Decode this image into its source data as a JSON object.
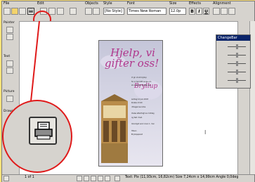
{
  "menu": {
    "file": "File",
    "edit": "Edit",
    "objects": "Objects",
    "style": "Style",
    "font": "Font",
    "size": "Size",
    "effects": "Effects",
    "alignment": "Alignment"
  },
  "toolbar": {
    "style_value": "[No Style]",
    "font_value": "Times New Roman",
    "size_value": "12.0p",
    "bold": "B",
    "italic": "I",
    "underline": "U"
  },
  "left_panel": {
    "pointer": "Pointer",
    "text": "Text",
    "picture": "Picture",
    "drawing": "Drawing"
  },
  "document": {
    "headline_line1": "Hjelp, vi",
    "headline_line2": "gifter oss!",
    "subtitle": "Bryllup",
    "body_lines": [
      "Vi gir ut et bryllup",
      "for vi har blitt enige om",
      "at vi ønsker å gifte oss.",
      "Lørdag 14 juni 2003",
      "Klokka 13.00",
      "i Bragernes kirke",
      "Vielse etterfulgt av middag",
      "og fest i fest.",
      "Vennligst svar innen 1. mai",
      "Hilsen",
      "Bryllupsparet"
    ]
  },
  "changebar": {
    "title": "ChangeBar"
  },
  "status": {
    "page": "1 of 1",
    "text": "Text: Pix (11,93cm, 16,82cm)  Size 7,24cm x 14,99cm  Angle 0,0deg"
  },
  "colors": {
    "accent": "#e01a1a",
    "desktop": "#ffe27a",
    "chrome": "#d6d3ce",
    "headline": "#b0368c"
  }
}
